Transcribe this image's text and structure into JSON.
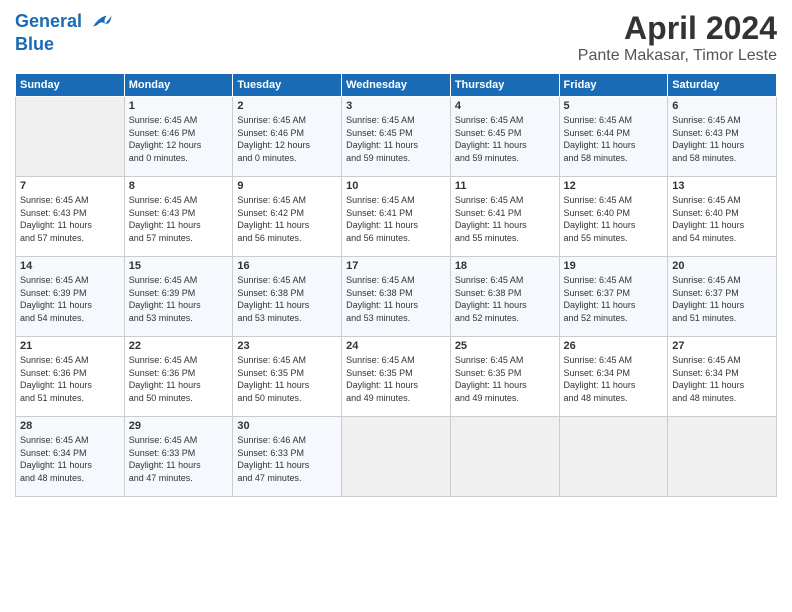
{
  "header": {
    "logo_line1": "General",
    "logo_line2": "Blue",
    "month": "April 2024",
    "location": "Pante Makasar, Timor Leste"
  },
  "days_of_week": [
    "Sunday",
    "Monday",
    "Tuesday",
    "Wednesday",
    "Thursday",
    "Friday",
    "Saturday"
  ],
  "weeks": [
    [
      {
        "day": "",
        "info": ""
      },
      {
        "day": "1",
        "info": "Sunrise: 6:45 AM\nSunset: 6:46 PM\nDaylight: 12 hours\nand 0 minutes."
      },
      {
        "day": "2",
        "info": "Sunrise: 6:45 AM\nSunset: 6:46 PM\nDaylight: 12 hours\nand 0 minutes."
      },
      {
        "day": "3",
        "info": "Sunrise: 6:45 AM\nSunset: 6:45 PM\nDaylight: 11 hours\nand 59 minutes."
      },
      {
        "day": "4",
        "info": "Sunrise: 6:45 AM\nSunset: 6:45 PM\nDaylight: 11 hours\nand 59 minutes."
      },
      {
        "day": "5",
        "info": "Sunrise: 6:45 AM\nSunset: 6:44 PM\nDaylight: 11 hours\nand 58 minutes."
      },
      {
        "day": "6",
        "info": "Sunrise: 6:45 AM\nSunset: 6:43 PM\nDaylight: 11 hours\nand 58 minutes."
      }
    ],
    [
      {
        "day": "7",
        "info": "Sunrise: 6:45 AM\nSunset: 6:43 PM\nDaylight: 11 hours\nand 57 minutes."
      },
      {
        "day": "8",
        "info": "Sunrise: 6:45 AM\nSunset: 6:43 PM\nDaylight: 11 hours\nand 57 minutes."
      },
      {
        "day": "9",
        "info": "Sunrise: 6:45 AM\nSunset: 6:42 PM\nDaylight: 11 hours\nand 56 minutes."
      },
      {
        "day": "10",
        "info": "Sunrise: 6:45 AM\nSunset: 6:41 PM\nDaylight: 11 hours\nand 56 minutes."
      },
      {
        "day": "11",
        "info": "Sunrise: 6:45 AM\nSunset: 6:41 PM\nDaylight: 11 hours\nand 55 minutes."
      },
      {
        "day": "12",
        "info": "Sunrise: 6:45 AM\nSunset: 6:40 PM\nDaylight: 11 hours\nand 55 minutes."
      },
      {
        "day": "13",
        "info": "Sunrise: 6:45 AM\nSunset: 6:40 PM\nDaylight: 11 hours\nand 54 minutes."
      }
    ],
    [
      {
        "day": "14",
        "info": "Sunrise: 6:45 AM\nSunset: 6:39 PM\nDaylight: 11 hours\nand 54 minutes."
      },
      {
        "day": "15",
        "info": "Sunrise: 6:45 AM\nSunset: 6:39 PM\nDaylight: 11 hours\nand 53 minutes."
      },
      {
        "day": "16",
        "info": "Sunrise: 6:45 AM\nSunset: 6:38 PM\nDaylight: 11 hours\nand 53 minutes."
      },
      {
        "day": "17",
        "info": "Sunrise: 6:45 AM\nSunset: 6:38 PM\nDaylight: 11 hours\nand 53 minutes."
      },
      {
        "day": "18",
        "info": "Sunrise: 6:45 AM\nSunset: 6:38 PM\nDaylight: 11 hours\nand 52 minutes."
      },
      {
        "day": "19",
        "info": "Sunrise: 6:45 AM\nSunset: 6:37 PM\nDaylight: 11 hours\nand 52 minutes."
      },
      {
        "day": "20",
        "info": "Sunrise: 6:45 AM\nSunset: 6:37 PM\nDaylight: 11 hours\nand 51 minutes."
      }
    ],
    [
      {
        "day": "21",
        "info": "Sunrise: 6:45 AM\nSunset: 6:36 PM\nDaylight: 11 hours\nand 51 minutes."
      },
      {
        "day": "22",
        "info": "Sunrise: 6:45 AM\nSunset: 6:36 PM\nDaylight: 11 hours\nand 50 minutes."
      },
      {
        "day": "23",
        "info": "Sunrise: 6:45 AM\nSunset: 6:35 PM\nDaylight: 11 hours\nand 50 minutes."
      },
      {
        "day": "24",
        "info": "Sunrise: 6:45 AM\nSunset: 6:35 PM\nDaylight: 11 hours\nand 49 minutes."
      },
      {
        "day": "25",
        "info": "Sunrise: 6:45 AM\nSunset: 6:35 PM\nDaylight: 11 hours\nand 49 minutes."
      },
      {
        "day": "26",
        "info": "Sunrise: 6:45 AM\nSunset: 6:34 PM\nDaylight: 11 hours\nand 48 minutes."
      },
      {
        "day": "27",
        "info": "Sunrise: 6:45 AM\nSunset: 6:34 PM\nDaylight: 11 hours\nand 48 minutes."
      }
    ],
    [
      {
        "day": "28",
        "info": "Sunrise: 6:45 AM\nSunset: 6:34 PM\nDaylight: 11 hours\nand 48 minutes."
      },
      {
        "day": "29",
        "info": "Sunrise: 6:45 AM\nSunset: 6:33 PM\nDaylight: 11 hours\nand 47 minutes."
      },
      {
        "day": "30",
        "info": "Sunrise: 6:46 AM\nSunset: 6:33 PM\nDaylight: 11 hours\nand 47 minutes."
      },
      {
        "day": "",
        "info": ""
      },
      {
        "day": "",
        "info": ""
      },
      {
        "day": "",
        "info": ""
      },
      {
        "day": "",
        "info": ""
      }
    ]
  ]
}
